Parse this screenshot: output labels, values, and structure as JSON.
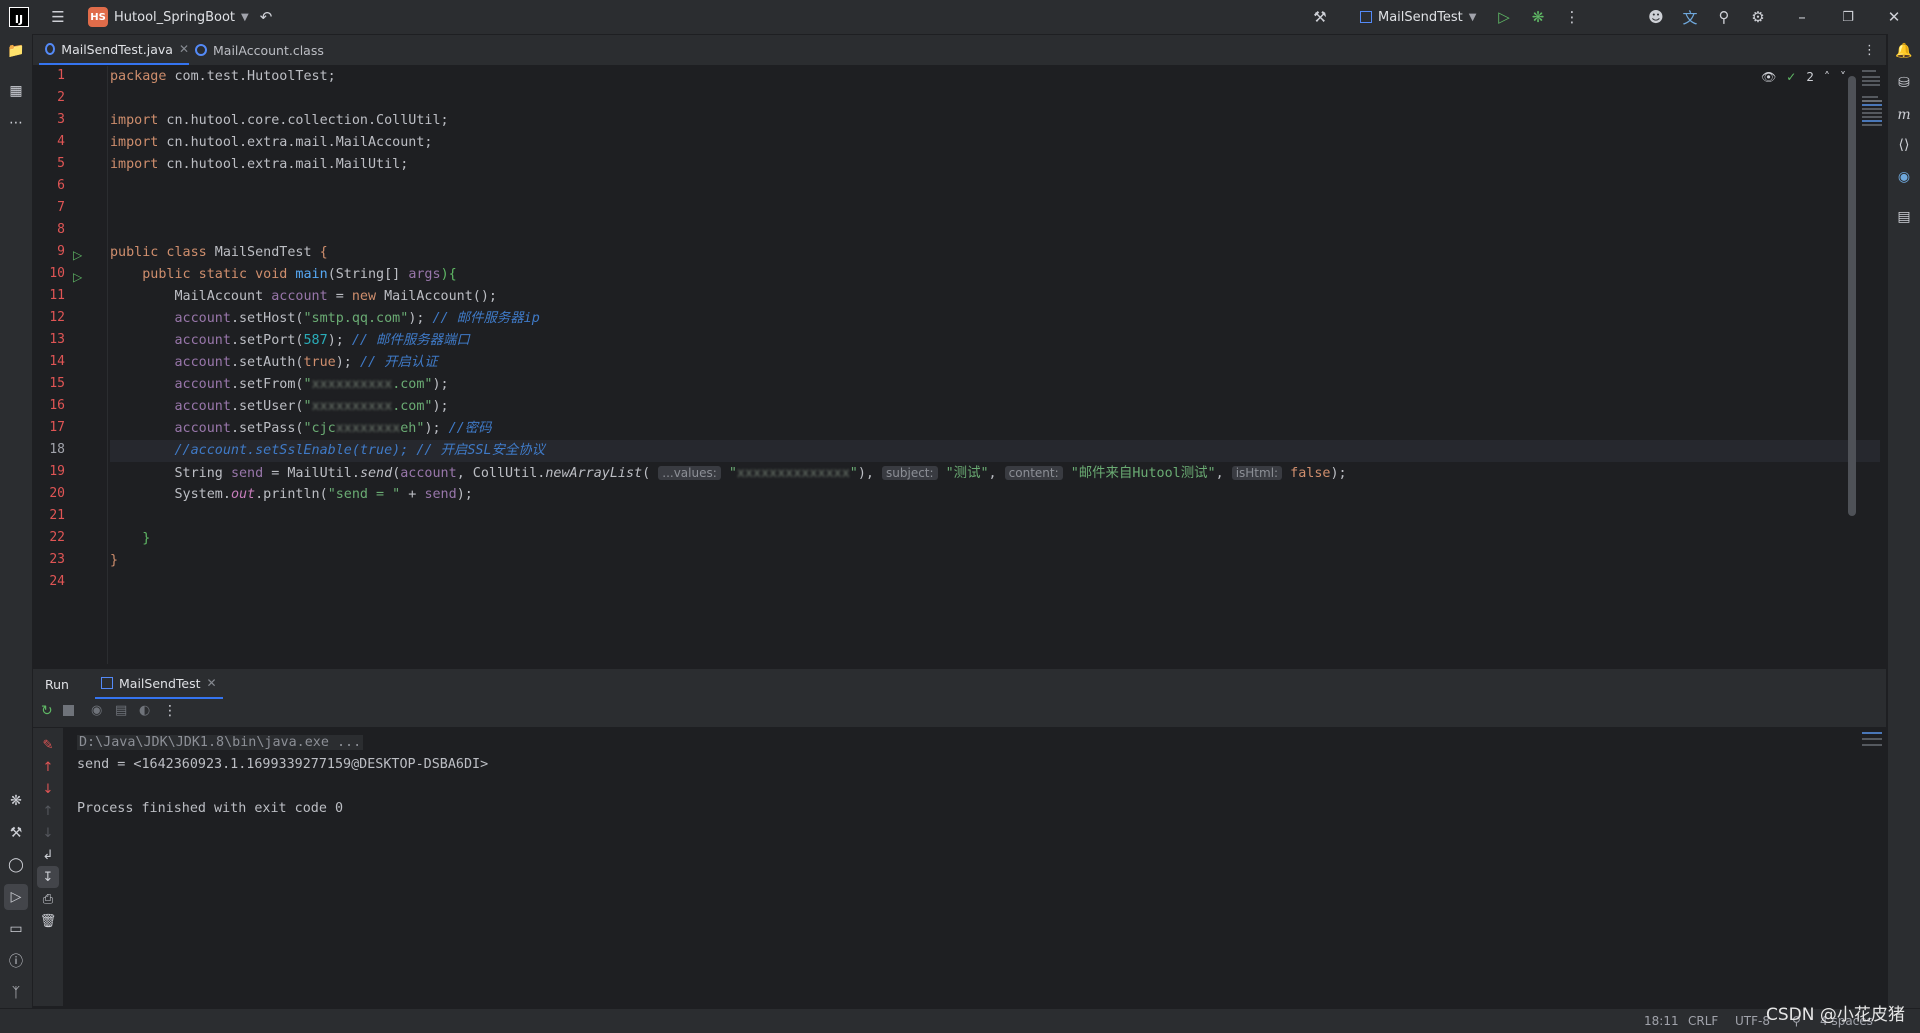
{
  "titlebar": {
    "project_badge": "HS",
    "project_name": "Hutool_SpringBoot",
    "run_config": "MailSendTest"
  },
  "tabs": [
    {
      "label": "MailSendTest.java",
      "active": true
    },
    {
      "label": "MailAccount.class",
      "active": false
    }
  ],
  "editor": {
    "inspection_count": "2",
    "line_numbers": [
      "1",
      "2",
      "3",
      "4",
      "5",
      "6",
      "7",
      "8",
      "9",
      "10",
      "11",
      "12",
      "13",
      "14",
      "15",
      "16",
      "17",
      "18",
      "19",
      "20",
      "21",
      "22",
      "23",
      "24"
    ],
    "current_line": 18,
    "code": {
      "l1": {
        "kw": "package",
        "rest": " com.test.HutoolTest;"
      },
      "l3": {
        "kw": "import",
        "rest": " cn.hutool.core.collection.CollUtil;"
      },
      "l4": {
        "kw": "import",
        "rest": " cn.hutool.extra.mail.MailAccount;"
      },
      "l5": {
        "kw": "import",
        "rest": " cn.hutool.extra.mail.MailUtil;"
      },
      "l9": {
        "kw": "public class",
        "name": " MailSendTest ",
        "brace": "{"
      },
      "l10": {
        "kw": "public static void",
        "method": " main",
        "sig": "(String[] ",
        "param": "args",
        "end": "){"
      },
      "l11": {
        "type": "MailAccount ",
        "var": "account",
        "eq": " = ",
        "kw": "new",
        "rest": " MailAccount();"
      },
      "l12": {
        "var": "account",
        "call": ".setHost(",
        "str": "\"smtp.qq.com\"",
        "end": "); ",
        "comment": "// 邮件服务器ip"
      },
      "l13": {
        "var": "account",
        "call": ".setPort(",
        "num": "587",
        "end": "); ",
        "comment": "// 邮件服务器端口"
      },
      "l14": {
        "var": "account",
        "call": ".setAuth(",
        "kw": "true",
        "end": "); ",
        "comment": "// 开启认证"
      },
      "l15": {
        "var": "account",
        "call": ".setFrom(",
        "str_open": "\"",
        "blurred": "xxxxxxxxxx",
        "str_close": ".com\"",
        "end": ");"
      },
      "l16": {
        "var": "account",
        "call": ".setUser(",
        "str_open": "\"",
        "blurred": "xxxxxxxxxx",
        "str_close": ".com\"",
        "end": ");"
      },
      "l17": {
        "var": "account",
        "call": ".setPass(",
        "str_open": "\"cjc",
        "blurred": "xxxxxxxx",
        "str_close": "eh\"",
        "end": "); ",
        "comment": "//密码"
      },
      "l18": {
        "comment": "//account.setSslEnable(true); // 开启SSL安全协议"
      },
      "l19": {
        "type": "String ",
        "var": "send",
        "eq": " = MailUtil.",
        "method": "send",
        "open": "(",
        "arg1": "account",
        "sep1": ", CollUtil.",
        "method2": "newArrayList",
        "open2": "(",
        "hint1": "...values:",
        "str1_open": "\"",
        "blurred": "xxxxxxxxxxxxxx",
        "str1_close": "\"",
        "sep2": "), ",
        "hint2": "subject:",
        "str2": "\"测试\"",
        "sep3": ", ",
        "hint3": "content:",
        "str3": "\"邮件来自Hutool测试\"",
        "sep4": ", ",
        "hint4": "isHtml:",
        "kw": "false",
        "end": ");"
      },
      "l20": {
        "type": "System.",
        "field": "out",
        "call": ".println(",
        "str": "\"send = \"",
        "plus": " + ",
        "var": "send",
        "end": ");"
      },
      "l22": {
        "brace": "}"
      },
      "l23": {
        "brace": "}"
      }
    }
  },
  "run": {
    "panel_label": "Run",
    "tab_label": "MailSendTest",
    "console": {
      "command": "D:\\Java\\JDK\\JDK1.8\\bin\\java.exe ...",
      "output": "send = <1642360923.1.1699339277159@DESKTOP-DSBA6DI>",
      "exit": "Process finished with exit code 0"
    }
  },
  "statusbar": {
    "position": "18:11",
    "line_sep": "CRLF",
    "encoding": "UTF-8",
    "indent": "4 spaces"
  },
  "watermark": "CSDN @小花皮猪"
}
